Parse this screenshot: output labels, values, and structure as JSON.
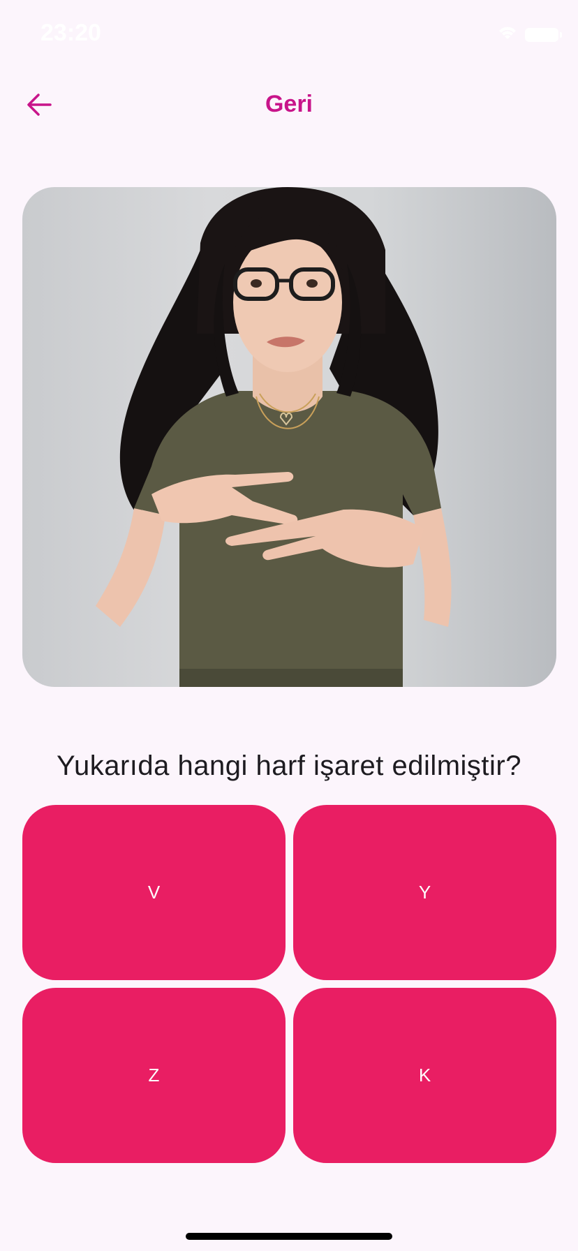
{
  "status_bar": {
    "time": "23:20"
  },
  "header": {
    "title": "Geri"
  },
  "question": {
    "text": "Yukarıda hangi harf işaret edilmiştir?"
  },
  "answers": [
    {
      "label": "V"
    },
    {
      "label": "Y"
    },
    {
      "label": "Z"
    },
    {
      "label": "K"
    }
  ],
  "colors": {
    "accent": "#c8148a",
    "answer_button": "#e91e63",
    "background": "#fcf5fc"
  }
}
